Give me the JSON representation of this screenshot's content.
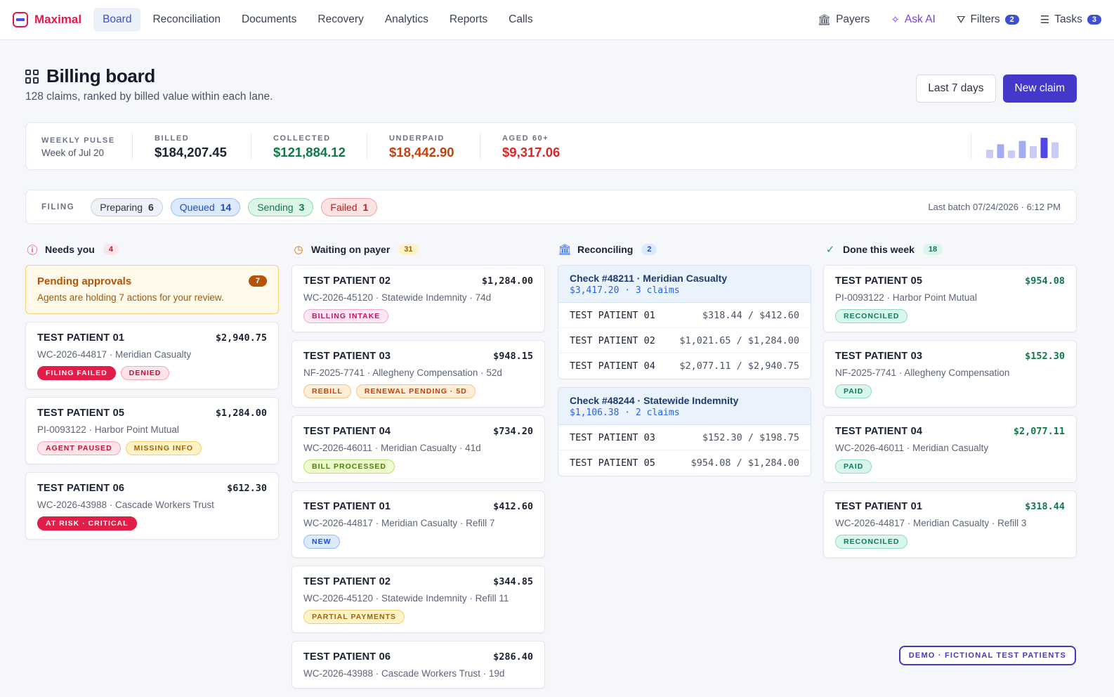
{
  "brand": {
    "name": "Maximal"
  },
  "nav": [
    "Board",
    "Reconciliation",
    "Documents",
    "Recovery",
    "Analytics",
    "Reports",
    "Calls"
  ],
  "topright": {
    "payers": "Payers",
    "ask_ai": "Ask AI",
    "filters": "Filters",
    "filters_count": "2",
    "tasks": "Tasks",
    "tasks_count": "3"
  },
  "header": {
    "title": "Billing board",
    "subtitle": "128 claims, ranked by billed value within each lane.",
    "range_button": "Last 7 days",
    "new_button": "New claim"
  },
  "pulse": {
    "caption": "WEEKLY PULSE",
    "week": "Week of Jul 20",
    "billed_label": "BILLED",
    "billed": "$184,207.45",
    "collected_label": "COLLECTED",
    "collected": "$121,884.12",
    "underpaid_label": "UNDERPAID",
    "underpaid": "$18,442.90",
    "aged_label": "AGED 60+",
    "aged": "$9,317.06",
    "spark": [
      0.35,
      0.58,
      0.32,
      0.72,
      0.5,
      0.85,
      0.66
    ]
  },
  "filing": {
    "caption": "FILING",
    "pills": [
      {
        "label": "Preparing",
        "count": "6"
      },
      {
        "label": "Queued",
        "count": "14"
      },
      {
        "label": "Sending",
        "count": "3"
      },
      {
        "label": "Failed",
        "count": "1"
      }
    ],
    "last_batch": "Last batch 07/24/2026 · 6:12 PM"
  },
  "needs": {
    "title": "Needs you",
    "count": "4",
    "alert": {
      "title": "Pending approvals",
      "text": "Agents are holding 7 actions for your review.",
      "count": "7"
    },
    "cards": [
      {
        "name": "TEST PATIENT 01",
        "amount": "$2,940.75",
        "meta": "WC-2026-44817 · Meridian Casualty",
        "tags": [
          "FILING FAILED",
          "DENIED"
        ]
      },
      {
        "name": "TEST PATIENT 05",
        "amount": "$1,284.00",
        "meta": "PI-0093122 · Harbor Point Mutual",
        "tags": [
          "AGENT PAUSED",
          "MISSING INFO"
        ]
      },
      {
        "name": "TEST PATIENT 06",
        "amount": "$612.30",
        "meta": "WC-2026-43988 · Cascade Workers Trust",
        "tags": [
          "AT RISK · CRITICAL"
        ]
      }
    ]
  },
  "waiting": {
    "title": "Waiting on payer",
    "count": "31",
    "cards": [
      {
        "name": "TEST PATIENT 02",
        "amount": "$1,284.00",
        "meta": "WC-2026-45120 · Statewide Indemnity · 74d",
        "tags": [
          "BILLING INTAKE"
        ]
      },
      {
        "name": "TEST PATIENT 03",
        "amount": "$948.15",
        "meta": "NF-2025-7741 · Allegheny Compensation · 52d",
        "tags": [
          "REBILL",
          "RENEWAL PENDING · 5D"
        ]
      },
      {
        "name": "TEST PATIENT 04",
        "amount": "$734.20",
        "meta": "WC-2026-46011 · Meridian Casualty · 41d",
        "tags": [
          "BILL PROCESSED"
        ]
      },
      {
        "name": "TEST PATIENT 01",
        "amount": "$412.60",
        "meta": "WC-2026-44817 · Meridian Casualty · Refill 7",
        "tags": [
          "NEW"
        ]
      },
      {
        "name": "TEST PATIENT 02",
        "amount": "$344.85",
        "meta": "WC-2026-45120 · Statewide Indemnity · Refill 11",
        "tags": [
          "PARTIAL PAYMENTS"
        ]
      },
      {
        "name": "TEST PATIENT 06",
        "amount": "$286.40",
        "meta": "WC-2026-43988 · Cascade Workers Trust · 19d",
        "tags": []
      }
    ]
  },
  "reconciling": {
    "title": "Reconciling",
    "count": "2",
    "checks": [
      {
        "title": "Check #48211 · Meridian Casualty",
        "sub": "$3,417.20 · 3 claims",
        "rows": [
          {
            "name": "TEST PATIENT 01",
            "vals": "$318.44 / $412.60"
          },
          {
            "name": "TEST PATIENT 02",
            "vals": "$1,021.65 / $1,284.00"
          },
          {
            "name": "TEST PATIENT 04",
            "vals": "$2,077.11 / $2,940.75"
          }
        ]
      },
      {
        "title": "Check #48244 · Statewide Indemnity",
        "sub": "$1,106.38 · 2 claims",
        "rows": [
          {
            "name": "TEST PATIENT 03",
            "vals": "$152.30 / $198.75"
          },
          {
            "name": "TEST PATIENT 05",
            "vals": "$954.08 / $1,284.00"
          }
        ]
      }
    ]
  },
  "done": {
    "title": "Done this week",
    "count": "18",
    "cards": [
      {
        "name": "TEST PATIENT 05",
        "amount": "$954.08",
        "meta": "PI-0093122 · Harbor Point Mutual",
        "tags": [
          "RECONCILED"
        ]
      },
      {
        "name": "TEST PATIENT 03",
        "amount": "$152.30",
        "meta": "NF-2025-7741 · Allegheny Compensation",
        "tags": [
          "PAID"
        ]
      },
      {
        "name": "TEST PATIENT 04",
        "amount": "$2,077.11",
        "meta": "WC-2026-46011 · Meridian Casualty",
        "tags": [
          "PAID"
        ]
      },
      {
        "name": "TEST PATIENT 01",
        "amount": "$318.44",
        "meta": "WC-2026-44817 · Meridian Casualty · Refill 3",
        "tags": [
          "RECONCILED"
        ]
      }
    ]
  },
  "demo_badge": "DEMO · FICTIONAL TEST PATIENTS",
  "colors": {
    "accent": "#4338ca",
    "brand": "#e4184a",
    "collected": "#0f7a49",
    "underpaid": "#c2410c",
    "aged": "#dc2626"
  }
}
